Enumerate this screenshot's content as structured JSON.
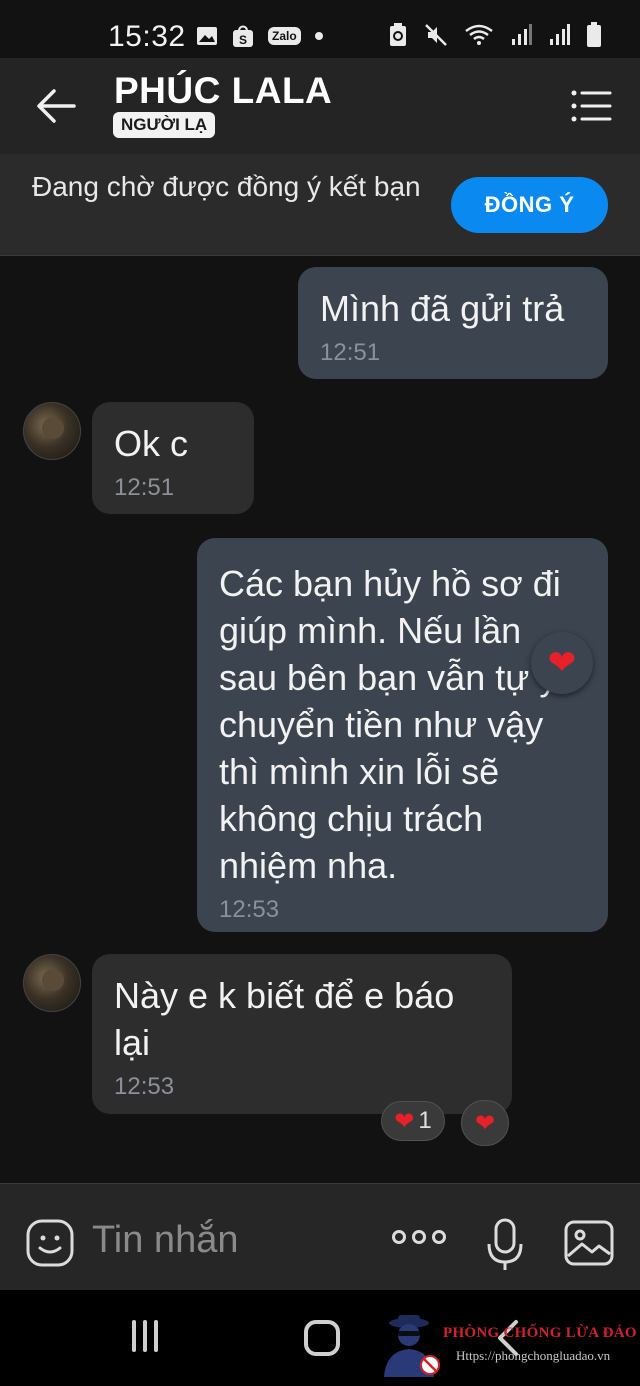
{
  "status_bar": {
    "time": "15:32",
    "zalo_tag": "Zalo",
    "left_icons": [
      "gallery-icon",
      "shopee-icon",
      "zalo-icon",
      "dot-icon"
    ],
    "right_icons": [
      "recycle-icon",
      "mute-icon",
      "wifi-icon",
      "signal-icon",
      "signal-icon",
      "battery-icon"
    ]
  },
  "header": {
    "contact_name": "PHÚC LALA",
    "badge": "NGƯỜI LẠ"
  },
  "friend_request": {
    "text": "Đang chờ được đồng ý kết bạn",
    "accept_label": "ĐỒNG Ý"
  },
  "messages": [
    {
      "side": "out",
      "text": "Mình đã gửi trả",
      "time": "12:51"
    },
    {
      "side": "in",
      "text": "Ok c",
      "time": "12:51"
    },
    {
      "side": "out",
      "text": "Các bạn hủy hồ sơ đi giúp mình. Nếu lần sau bên bạn vẫn tự ý chuyển tiền như vậy thì mình xin lỗi sẽ không chịu trách nhiệm nha.",
      "time": "12:53",
      "reaction": "❤"
    },
    {
      "side": "in",
      "text": "Này e k biết để e báo lại",
      "time": "12:53",
      "reaction_count": "1"
    }
  ],
  "reactions": {
    "heart": "❤",
    "count": "1"
  },
  "composer": {
    "placeholder": "Tin nhắn"
  },
  "watermark": {
    "title": "PHÒNG CHỐNG LỪA ĐẢO",
    "url": "Https://phongchongluadao.vn"
  },
  "colors": {
    "background": "#121212",
    "outgoing_bubble": "#3c4450",
    "incoming_bubble": "#2d2d2d",
    "accent": "#0a8af0",
    "heart": "#e8202a"
  }
}
